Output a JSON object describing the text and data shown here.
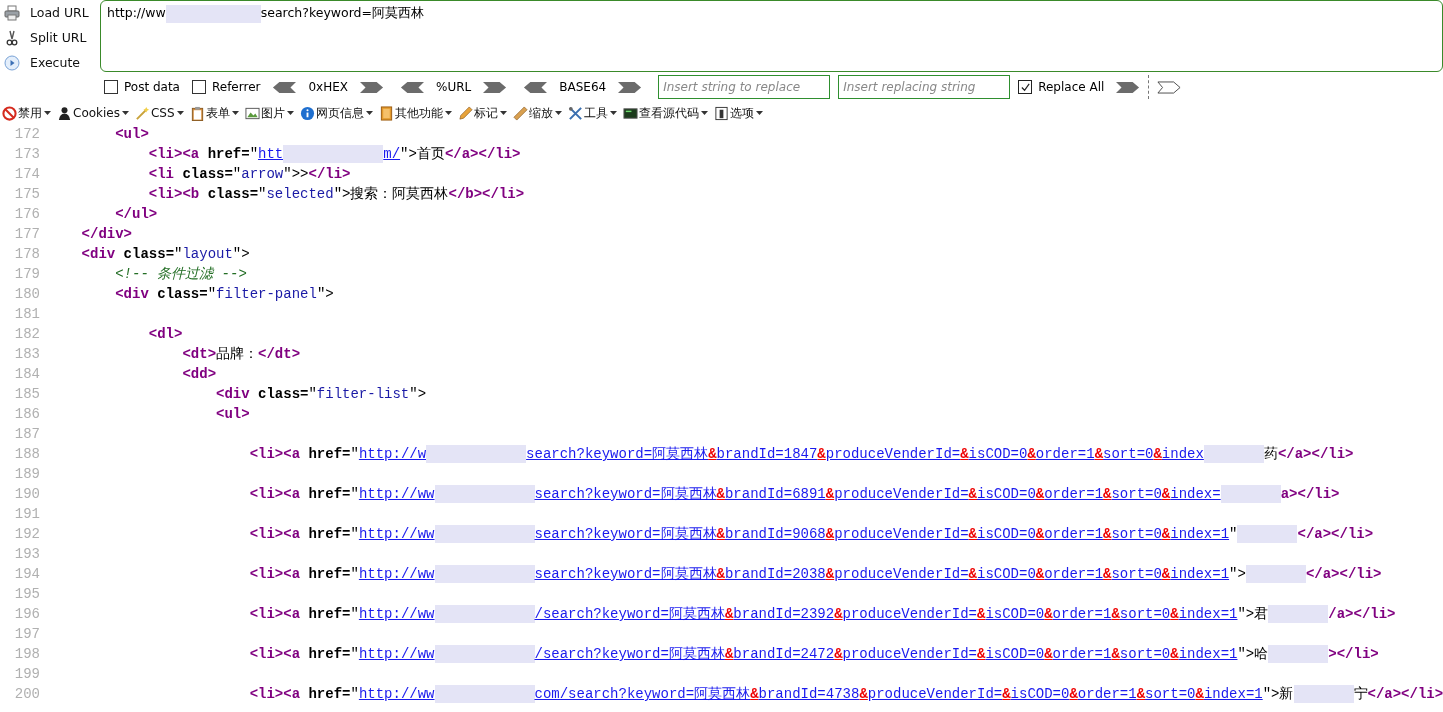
{
  "hackbar": {
    "actions": [
      {
        "label": "Load URL"
      },
      {
        "label": "Split URL"
      },
      {
        "label": "Execute"
      }
    ],
    "url": {
      "start": "http://ww",
      "end": "search?keyword=阿莫西林"
    },
    "controls": [
      {
        "kind": "checkbox",
        "label": "Post data",
        "checked": false
      },
      {
        "kind": "checkbox",
        "label": "Referrer",
        "checked": false
      },
      {
        "kind": "encoder",
        "label": "0xHEX"
      },
      {
        "kind": "encoder",
        "label": "%URL"
      },
      {
        "kind": "encoder",
        "label": "BASE64"
      },
      {
        "kind": "field",
        "placeholder": "Insert string to replace"
      },
      {
        "kind": "field",
        "placeholder": "Insert replacing string"
      },
      {
        "kind": "checkbox",
        "label": "Replace All",
        "checked": true
      },
      {
        "kind": "go"
      },
      {
        "kind": "more"
      }
    ]
  },
  "toolbar": [
    {
      "label": "禁用"
    },
    {
      "label": "Cookies"
    },
    {
      "label": "CSS"
    },
    {
      "label": "表单"
    },
    {
      "label": "图片"
    },
    {
      "label": "网页信息"
    },
    {
      "label": "其他功能"
    },
    {
      "label": "标记"
    },
    {
      "label": "缩放"
    },
    {
      "label": "工具"
    },
    {
      "label": "查看源代码"
    },
    {
      "label": "选项"
    }
  ],
  "source": {
    "lines": [
      {
        "number": "172",
        "tokens": [
          {
            "kind": "tag",
            "text": "        <ul>"
          }
        ]
      },
      {
        "number": "173",
        "tokens": [
          {
            "kind": "tag",
            "text": "            <li><a"
          },
          {
            "kind": "attr",
            "text": " href="
          },
          {
            "kind": "punct",
            "text": "\""
          },
          {
            "kind": "link",
            "text": "htt"
          },
          {
            "kind": "redacted"
          },
          {
            "kind": "link",
            "text": "m/"
          },
          {
            "kind": "punct",
            "text": "\">首页"
          },
          {
            "kind": "tag",
            "text": "</a></li>"
          }
        ]
      },
      {
        "number": "174",
        "tokens": [
          {
            "kind": "tag",
            "text": "            <li"
          },
          {
            "kind": "attr",
            "text": " class="
          },
          {
            "kind": "punct",
            "text": "\""
          },
          {
            "kind": "value",
            "text": "arrow"
          },
          {
            "kind": "punct",
            "text": "\">>"
          },
          {
            "kind": "tag",
            "text": "</li>"
          }
        ]
      },
      {
        "number": "175",
        "tokens": [
          {
            "kind": "tag",
            "text": "            <li><b"
          },
          {
            "kind": "attr",
            "text": " class="
          },
          {
            "kind": "punct",
            "text": "\""
          },
          {
            "kind": "value",
            "text": "selected"
          },
          {
            "kind": "punct",
            "text": "\">搜索：阿莫西林"
          },
          {
            "kind": "tag",
            "text": "</b></li>"
          }
        ]
      },
      {
        "number": "176",
        "tokens": [
          {
            "kind": "tag",
            "text": "        </ul>"
          }
        ]
      },
      {
        "number": "177",
        "tokens": [
          {
            "kind": "tag",
            "text": "    </div>"
          }
        ]
      },
      {
        "number": "178",
        "tokens": [
          {
            "kind": "tag",
            "text": "    <div"
          },
          {
            "kind": "attr",
            "text": " class="
          },
          {
            "kind": "punct",
            "text": "\""
          },
          {
            "kind": "value",
            "text": "layout"
          },
          {
            "kind": "punct",
            "text": "\">"
          }
        ]
      },
      {
        "number": "179",
        "tokens": [
          {
            "kind": "comment",
            "text": "        <!-- 条件过滤 -->"
          }
        ]
      },
      {
        "number": "180",
        "tokens": [
          {
            "kind": "tag",
            "text": "        <div"
          },
          {
            "kind": "attr",
            "text": " class="
          },
          {
            "kind": "punct",
            "text": "\""
          },
          {
            "kind": "value",
            "text": "filter-panel"
          },
          {
            "kind": "punct",
            "text": "\">"
          }
        ]
      },
      {
        "number": "181"
      },
      {
        "number": "182",
        "tokens": [
          {
            "kind": "tag",
            "text": "            <dl>"
          }
        ]
      },
      {
        "number": "183",
        "tokens": [
          {
            "kind": "tag",
            "text": "                <dt>"
          },
          {
            "kind": "punct",
            "text": "品牌："
          },
          {
            "kind": "tag",
            "text": "</dt>"
          }
        ]
      },
      {
        "number": "184",
        "tokens": [
          {
            "kind": "tag",
            "text": "                <dd>"
          }
        ]
      },
      {
        "number": "185",
        "tokens": [
          {
            "kind": "tag",
            "text": "                    <div"
          },
          {
            "kind": "attr",
            "text": " class="
          },
          {
            "kind": "punct",
            "text": "\""
          },
          {
            "kind": "value",
            "text": "filter-list"
          },
          {
            "kind": "punct",
            "text": "\">"
          }
        ]
      },
      {
        "number": "186",
        "tokens": [
          {
            "kind": "tag",
            "text": "                    <ul>"
          }
        ]
      },
      {
        "number": "187"
      },
      {
        "number": "188",
        "tokens": [
          {
            "kind": "tag",
            "text": "                        <li><a"
          },
          {
            "kind": "attr",
            "text": " href="
          },
          {
            "kind": "punct",
            "text": "\""
          },
          {
            "kind": "link",
            "text": "http://w"
          },
          {
            "kind": "redacted"
          },
          {
            "kind": "link",
            "text": "search?keyword=阿莫西林"
          },
          {
            "kind": "amp",
            "text": "&"
          },
          {
            "kind": "link",
            "text": "brandId=1847"
          },
          {
            "kind": "amp",
            "text": "&"
          },
          {
            "kind": "link",
            "text": "produceVenderId="
          },
          {
            "kind": "amp",
            "text": "&"
          },
          {
            "kind": "link",
            "text": "isCOD=0"
          },
          {
            "kind": "amp",
            "text": "&"
          },
          {
            "kind": "link",
            "text": "order=1"
          },
          {
            "kind": "amp",
            "text": "&"
          },
          {
            "kind": "link",
            "text": "sort=0"
          },
          {
            "kind": "amp",
            "text": "&"
          },
          {
            "kind": "link",
            "text": "index"
          },
          {
            "kind": "redacted"
          },
          {
            "kind": "punct",
            "text": "药"
          },
          {
            "kind": "tag",
            "text": "</a></li>"
          }
        ]
      },
      {
        "number": "189"
      },
      {
        "number": "190",
        "tokens": [
          {
            "kind": "tag",
            "text": "                        <li><a"
          },
          {
            "kind": "attr",
            "text": " href="
          },
          {
            "kind": "punct",
            "text": "\""
          },
          {
            "kind": "link",
            "text": "http://ww"
          },
          {
            "kind": "redacted"
          },
          {
            "kind": "link",
            "text": "search?keyword=阿莫西林"
          },
          {
            "kind": "amp",
            "text": "&"
          },
          {
            "kind": "link",
            "text": "brandId=6891"
          },
          {
            "kind": "amp",
            "text": "&"
          },
          {
            "kind": "link",
            "text": "produceVenderId="
          },
          {
            "kind": "amp",
            "text": "&"
          },
          {
            "kind": "link",
            "text": "isCOD=0"
          },
          {
            "kind": "amp",
            "text": "&"
          },
          {
            "kind": "link",
            "text": "order=1"
          },
          {
            "kind": "amp",
            "text": "&"
          },
          {
            "kind": "link",
            "text": "sort=0"
          },
          {
            "kind": "amp",
            "text": "&"
          },
          {
            "kind": "link",
            "text": "index="
          },
          {
            "kind": "redacted"
          },
          {
            "kind": "tag",
            "text": "a></li>"
          }
        ]
      },
      {
        "number": "191"
      },
      {
        "number": "192",
        "tokens": [
          {
            "kind": "tag",
            "text": "                        <li><a"
          },
          {
            "kind": "attr",
            "text": " href="
          },
          {
            "kind": "punct",
            "text": "\""
          },
          {
            "kind": "link",
            "text": "http://ww"
          },
          {
            "kind": "redacted"
          },
          {
            "kind": "link",
            "text": "search?keyword=阿莫西林"
          },
          {
            "kind": "amp",
            "text": "&"
          },
          {
            "kind": "link",
            "text": "brandId=9068"
          },
          {
            "kind": "amp",
            "text": "&"
          },
          {
            "kind": "link",
            "text": "produceVenderId="
          },
          {
            "kind": "amp",
            "text": "&"
          },
          {
            "kind": "link",
            "text": "isCOD=0"
          },
          {
            "kind": "amp",
            "text": "&"
          },
          {
            "kind": "link",
            "text": "order=1"
          },
          {
            "kind": "amp",
            "text": "&"
          },
          {
            "kind": "link",
            "text": "sort=0"
          },
          {
            "kind": "amp",
            "text": "&"
          },
          {
            "kind": "link",
            "text": "index=1"
          },
          {
            "kind": "punct",
            "text": "\""
          },
          {
            "kind": "redacted"
          },
          {
            "kind": "tag",
            "text": "</a></li>"
          }
        ]
      },
      {
        "number": "193"
      },
      {
        "number": "194",
        "tokens": [
          {
            "kind": "tag",
            "text": "                        <li><a"
          },
          {
            "kind": "attr",
            "text": " href="
          },
          {
            "kind": "punct",
            "text": "\""
          },
          {
            "kind": "link",
            "text": "http://ww"
          },
          {
            "kind": "redacted"
          },
          {
            "kind": "link",
            "text": "search?keyword=阿莫西林"
          },
          {
            "kind": "amp",
            "text": "&"
          },
          {
            "kind": "link",
            "text": "brandId=2038"
          },
          {
            "kind": "amp",
            "text": "&"
          },
          {
            "kind": "link",
            "text": "produceVenderId="
          },
          {
            "kind": "amp",
            "text": "&"
          },
          {
            "kind": "link",
            "text": "isCOD=0"
          },
          {
            "kind": "amp",
            "text": "&"
          },
          {
            "kind": "link",
            "text": "order=1"
          },
          {
            "kind": "amp",
            "text": "&"
          },
          {
            "kind": "link",
            "text": "sort=0"
          },
          {
            "kind": "amp",
            "text": "&"
          },
          {
            "kind": "link",
            "text": "index=1"
          },
          {
            "kind": "punct",
            "text": "\">"
          },
          {
            "kind": "redacted"
          },
          {
            "kind": "tag",
            "text": "</a></li>"
          }
        ]
      },
      {
        "number": "195"
      },
      {
        "number": "196",
        "tokens": [
          {
            "kind": "tag",
            "text": "                        <li><a"
          },
          {
            "kind": "attr",
            "text": " href="
          },
          {
            "kind": "punct",
            "text": "\""
          },
          {
            "kind": "link",
            "text": "http://ww"
          },
          {
            "kind": "redacted"
          },
          {
            "kind": "link",
            "text": "/search?keyword=阿莫西林"
          },
          {
            "kind": "amp",
            "text": "&"
          },
          {
            "kind": "link",
            "text": "brandId=2392"
          },
          {
            "kind": "amp",
            "text": "&"
          },
          {
            "kind": "link",
            "text": "produceVenderId="
          },
          {
            "kind": "amp",
            "text": "&"
          },
          {
            "kind": "link",
            "text": "isCOD=0"
          },
          {
            "kind": "amp",
            "text": "&"
          },
          {
            "kind": "link",
            "text": "order=1"
          },
          {
            "kind": "amp",
            "text": "&"
          },
          {
            "kind": "link",
            "text": "sort=0"
          },
          {
            "kind": "amp",
            "text": "&"
          },
          {
            "kind": "link",
            "text": "index=1"
          },
          {
            "kind": "punct",
            "text": "\">君"
          },
          {
            "kind": "redacted"
          },
          {
            "kind": "tag",
            "text": "/a></li>"
          }
        ]
      },
      {
        "number": "197"
      },
      {
        "number": "198",
        "tokens": [
          {
            "kind": "tag",
            "text": "                        <li><a"
          },
          {
            "kind": "attr",
            "text": " href="
          },
          {
            "kind": "punct",
            "text": "\""
          },
          {
            "kind": "link",
            "text": "http://ww"
          },
          {
            "kind": "redacted"
          },
          {
            "kind": "link",
            "text": "/search?keyword=阿莫西林"
          },
          {
            "kind": "amp",
            "text": "&"
          },
          {
            "kind": "link",
            "text": "brandId=2472"
          },
          {
            "kind": "amp",
            "text": "&"
          },
          {
            "kind": "link",
            "text": "produceVenderId="
          },
          {
            "kind": "amp",
            "text": "&"
          },
          {
            "kind": "link",
            "text": "isCOD=0"
          },
          {
            "kind": "amp",
            "text": "&"
          },
          {
            "kind": "link",
            "text": "order=1"
          },
          {
            "kind": "amp",
            "text": "&"
          },
          {
            "kind": "link",
            "text": "sort=0"
          },
          {
            "kind": "amp",
            "text": "&"
          },
          {
            "kind": "link",
            "text": "index=1"
          },
          {
            "kind": "punct",
            "text": "\">哈"
          },
          {
            "kind": "redacted"
          },
          {
            "kind": "tag",
            "text": "></li>"
          }
        ]
      },
      {
        "number": "199"
      },
      {
        "number": "200",
        "tokens": [
          {
            "kind": "tag",
            "text": "                        <li><a"
          },
          {
            "kind": "attr",
            "text": " href="
          },
          {
            "kind": "punct",
            "text": "\""
          },
          {
            "kind": "link",
            "text": "http://ww"
          },
          {
            "kind": "redacted"
          },
          {
            "kind": "link",
            "text": "com/search?keyword=阿莫西林"
          },
          {
            "kind": "amp",
            "text": "&"
          },
          {
            "kind": "link",
            "text": "brandId=4738"
          },
          {
            "kind": "amp",
            "text": "&"
          },
          {
            "kind": "link",
            "text": "produceVenderId="
          },
          {
            "kind": "amp",
            "text": "&"
          },
          {
            "kind": "link",
            "text": "isCOD=0"
          },
          {
            "kind": "amp",
            "text": "&"
          },
          {
            "kind": "link",
            "text": "order=1"
          },
          {
            "kind": "amp",
            "text": "&"
          },
          {
            "kind": "link",
            "text": "sort=0"
          },
          {
            "kind": "amp",
            "text": "&"
          },
          {
            "kind": "link",
            "text": "index=1"
          },
          {
            "kind": "punct",
            "text": "\">新"
          },
          {
            "kind": "redacted"
          },
          {
            "kind": "punct",
            "text": "宁"
          },
          {
            "kind": "tag",
            "text": "</a></li>"
          }
        ]
      }
    ]
  }
}
